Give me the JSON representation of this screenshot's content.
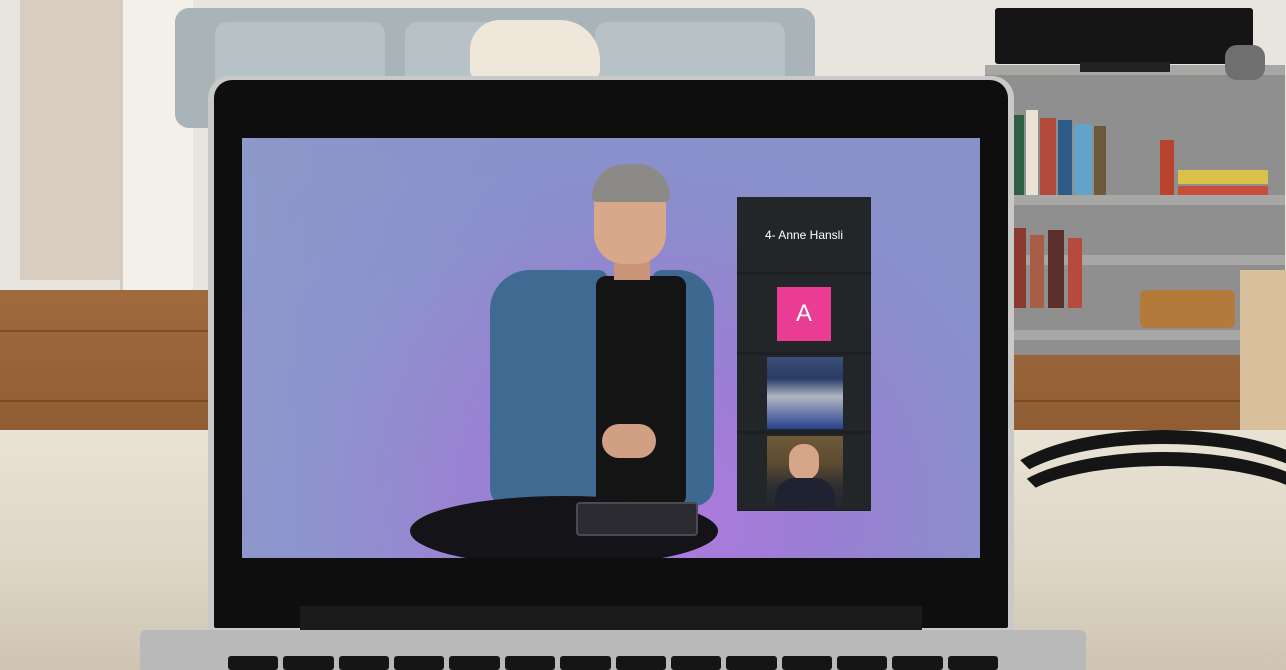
{
  "participants_panel": {
    "tiles": [
      {
        "type": "name",
        "label": "4- Anne Hansli"
      },
      {
        "type": "avatar",
        "initial": "A",
        "avatar_color": "#ea3c93"
      },
      {
        "type": "video",
        "content": "crowd-stage-icon"
      },
      {
        "type": "video",
        "content": "person-with-glasses-icon"
      }
    ]
  },
  "colors": {
    "screen_background": "#8a8fcc",
    "panel_background": "#1d1f22",
    "avatar_pink": "#ea3c93"
  }
}
